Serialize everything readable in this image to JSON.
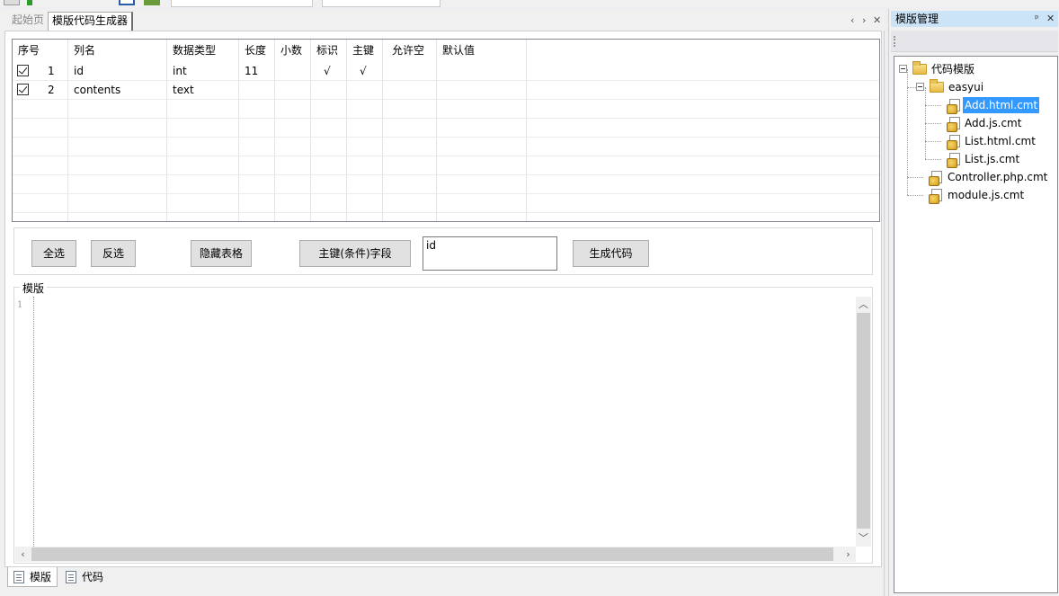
{
  "doc_tabs": {
    "start_page": "起始页",
    "active_tab": "模版代码生成器"
  },
  "grid": {
    "columns": [
      "序号",
      "列名",
      "数据类型",
      "长度",
      "小数",
      "标识",
      "主键",
      "允许空",
      "默认值"
    ],
    "rows": [
      {
        "checked": true,
        "index": "1",
        "name": "id",
        "type": "int",
        "length": "11",
        "decimal": "",
        "identity": "√",
        "primary": "√",
        "nullable": "",
        "default": ""
      },
      {
        "checked": true,
        "index": "2",
        "name": "contents",
        "type": "text",
        "length": "",
        "decimal": "",
        "identity": "",
        "primary": "",
        "nullable": "",
        "default": ""
      }
    ]
  },
  "buttons": {
    "select_all": "全选",
    "invert": "反选",
    "hide_grid": "隐藏表格",
    "pk_field": "主键(条件)字段",
    "generate": "生成代码"
  },
  "pk_input": {
    "value": "id"
  },
  "template": {
    "legend": "模版",
    "line_number": "1"
  },
  "bottom_tabs": {
    "template": "模版",
    "code": "代码"
  },
  "side_panel": {
    "title": "模版管理",
    "pin_icon": "pin-icon",
    "close_icon": "close-icon",
    "tree": {
      "root": "代码模版",
      "folder": "easyui",
      "folder_files": [
        "Add.html.cmt",
        "Add.js.cmt",
        "List.html.cmt",
        "List.js.cmt"
      ],
      "root_files": [
        "Controller.php.cmt",
        "module.js.cmt"
      ],
      "selected": "Add.html.cmt"
    }
  }
}
